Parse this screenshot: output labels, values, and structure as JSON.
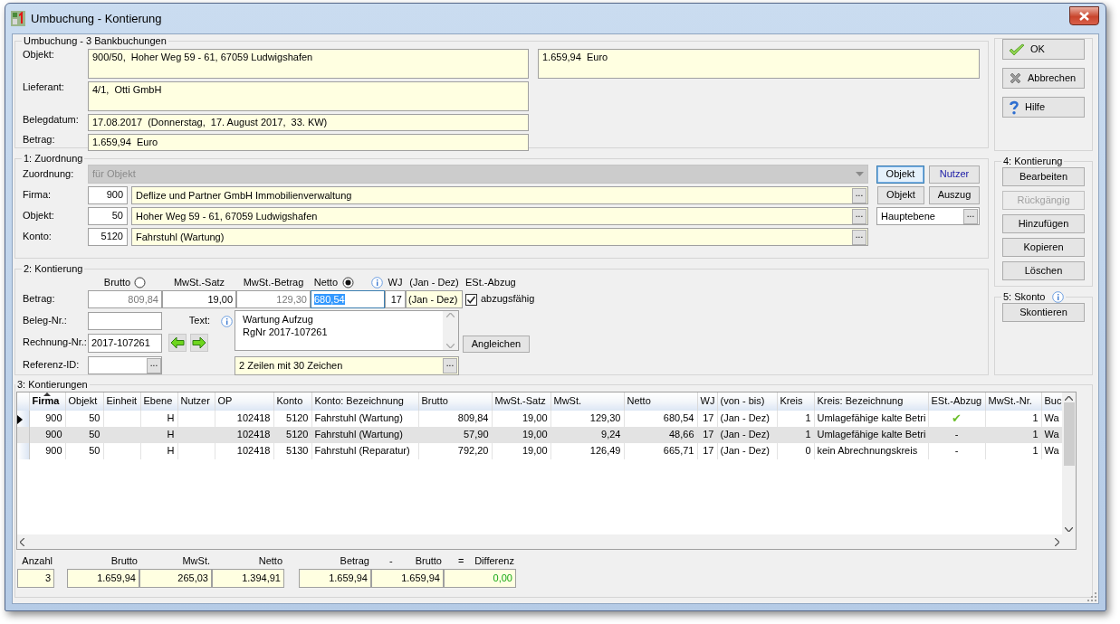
{
  "window": {
    "title": "Umbuchung - Kontierung"
  },
  "summary": {
    "legend": "Umbuchung - 3 Bankbuchungen",
    "side_value": "1.659,94  Euro",
    "fields": [
      {
        "label": "Objekt:",
        "value": "900/50,  Hoher Weg 59 - 61, 67059 Ludwigshafen",
        "kind": "tall"
      },
      {
        "label": "Lieferant:",
        "value": "4/1,  Otti GmbH",
        "kind": "tall"
      },
      {
        "label": "Belegdatum:",
        "value": "17.08.2017  (Donnerstag,  17. August 2017,  33. KW)",
        "kind": "line"
      },
      {
        "label": "Betrag:",
        "value": "1.659,94  Euro",
        "kind": "line"
      }
    ]
  },
  "zuordnung": {
    "legend": "1: Zuordnung",
    "select": {
      "label": "Zuordnung:",
      "value": "für Objekt",
      "disabled": true
    },
    "toggles": [
      {
        "label": "Objekt",
        "selected": true
      },
      {
        "label": "Nutzer",
        "selected": false
      }
    ],
    "rows": [
      {
        "label": "Firma:",
        "code": "900",
        "name": "Deflize und Partner GmbH Immobilienverwaltung",
        "button": "...",
        "buttons": [
          "Objekt",
          "Auszug"
        ]
      },
      {
        "label": "Objekt:",
        "code": "50",
        "name": "Hoher Weg 59 - 61, 67059 Ludwigshafen",
        "button": "...",
        "level_field": {
          "value": "Hauptebene",
          "button": "..."
        }
      },
      {
        "label": "Konto:",
        "code": "5120",
        "name": "Fahrstuhl (Wartung)",
        "button": "..."
      }
    ]
  },
  "kontierung": {
    "legend": "2: Kontierung",
    "basis": [
      {
        "label": "Brutto",
        "selected": false
      },
      {
        "label": "Netto",
        "selected": true
      }
    ],
    "headers": {
      "mwst_satz": "MwSt.-Satz",
      "mwst_betrag": "MwSt.-Betrag",
      "wj": "WJ",
      "period": "(Jan - Dez)",
      "est": "ESt.-Abzug"
    },
    "betrag": {
      "label": "Betrag:",
      "brutto": "809,84",
      "mwst_satz": "19,00",
      "mwst_betrag": "129,30",
      "netto": "680,54",
      "wj": "17",
      "period": "(Jan - Dez)"
    },
    "deductible": {
      "label": "abzugsfähig",
      "checked": true
    },
    "beleg": {
      "label": "Beleg-Nr.:"
    },
    "text": {
      "label": "Text:",
      "lines": [
        "Wartung Aufzug",
        "RgNr 2017-107261"
      ],
      "format": "2 Zeilen mit 30 Zeichen",
      "button": "..."
    },
    "rechnung": {
      "label": "Rechnung-Nr.:",
      "value": "2017-107261"
    },
    "referenz": {
      "label": "Referenz-ID:",
      "button": "..."
    },
    "adjust_button": "Angleichen"
  },
  "kontierungen": {
    "legend": "3: Kontierungen",
    "columns": [
      "Firma",
      "Objekt",
      "Einheit",
      "Ebene",
      "Nutzer",
      "OP",
      "Konto",
      "Konto: Bezeichnung",
      "Brutto",
      "MwSt.-Satz",
      "MwSt.",
      "Netto",
      "WJ",
      "(von - bis)",
      "Kreis",
      "Kreis: Bezeichnung",
      "ESt.-Abzug",
      "MwSt.-Nr.",
      "Buc"
    ],
    "rows": [
      {
        "selected": true,
        "cells": [
          "900",
          "50",
          "",
          "H",
          "",
          "102418",
          "5120",
          "Fahrstuhl (Wartung)",
          "809,84",
          "19,00",
          "129,30",
          "680,54",
          "17",
          "(Jan - Dez)",
          "1",
          "Umlagefähige kalte Betri",
          "✔",
          "1",
          "Wa"
        ]
      },
      {
        "selected": false,
        "cells": [
          "900",
          "50",
          "",
          "H",
          "",
          "102418",
          "5120",
          "Fahrstuhl (Wartung)",
          "57,90",
          "19,00",
          "9,24",
          "48,66",
          "17",
          "(Jan - Dez)",
          "1",
          "Umlagefähige kalte Betri",
          "-",
          "1",
          "Wa"
        ]
      },
      {
        "selected": false,
        "cells": [
          "900",
          "50",
          "",
          "H",
          "",
          "102418",
          "5130",
          "Fahrstuhl (Reparatur)",
          "792,20",
          "19,00",
          "126,49",
          "665,71",
          "17",
          "(Jan - Dez)",
          "0",
          "kein Abrechnungskreis",
          "-",
          "1",
          "Wa"
        ]
      }
    ],
    "count": {
      "label": "Anzahl",
      "value": "3"
    },
    "sums": [
      {
        "label": "Brutto",
        "value": "1.659,94"
      },
      {
        "label": "MwSt.",
        "value": "265,03"
      },
      {
        "label": "Netto",
        "value": "1.394,91"
      }
    ],
    "reconcile": {
      "betrag": {
        "label": "Betrag",
        "value": "1.659,94"
      },
      "minus": "-",
      "brutto": {
        "label": "Brutto",
        "value": "1.659,94"
      },
      "equals": "=",
      "difference": {
        "label": "Differenz",
        "value": "0,00"
      }
    }
  },
  "actions": [
    {
      "label": "OK",
      "kind": "ok"
    },
    {
      "label": "Abbrechen",
      "kind": "cancel"
    },
    {
      "label": "Hilfe",
      "kind": "help"
    }
  ],
  "kontierung_actions": {
    "legend": "4: Kontierung",
    "buttons": [
      {
        "label": "Bearbeiten",
        "disabled": false
      },
      {
        "label": "Rückgängig",
        "disabled": true
      },
      {
        "label": "Hinzufügen",
        "disabled": false
      },
      {
        "label": "Kopieren",
        "disabled": false
      },
      {
        "label": "Löschen",
        "disabled": false
      }
    ]
  },
  "skonto": {
    "legend": "5: Skonto",
    "button": "Skontieren"
  }
}
